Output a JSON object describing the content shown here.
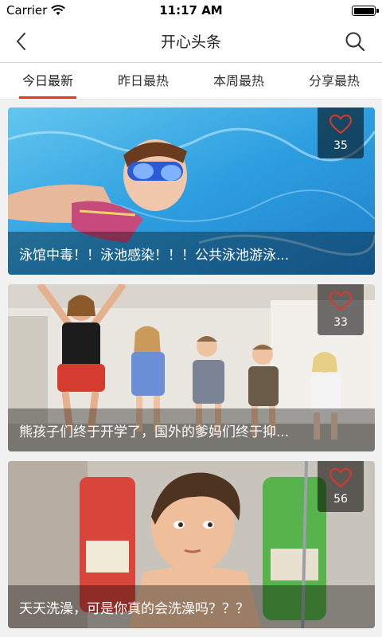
{
  "status_bar": {
    "carrier": "Carrier",
    "time": "11:17 AM"
  },
  "nav": {
    "title": "开心头条",
    "back_icon": "chevron-left-icon",
    "search_icon": "search-icon"
  },
  "tabs": [
    {
      "label": "今日最新",
      "active": true
    },
    {
      "label": "昨日最热",
      "active": false
    },
    {
      "label": "本周最热",
      "active": false
    },
    {
      "label": "分享最热",
      "active": false
    }
  ],
  "accent_color": "#e0352b",
  "feed": [
    {
      "title": "泳馆中毒！！泳池感染！！！公共泳池游泳...",
      "likes": "35"
    },
    {
      "title": "熊孩子们终于开学了，国外的爹妈们终于抑...",
      "likes": "33"
    },
    {
      "title": "天天洗澡，可是你真的会洗澡吗？？？",
      "likes": "56"
    }
  ]
}
